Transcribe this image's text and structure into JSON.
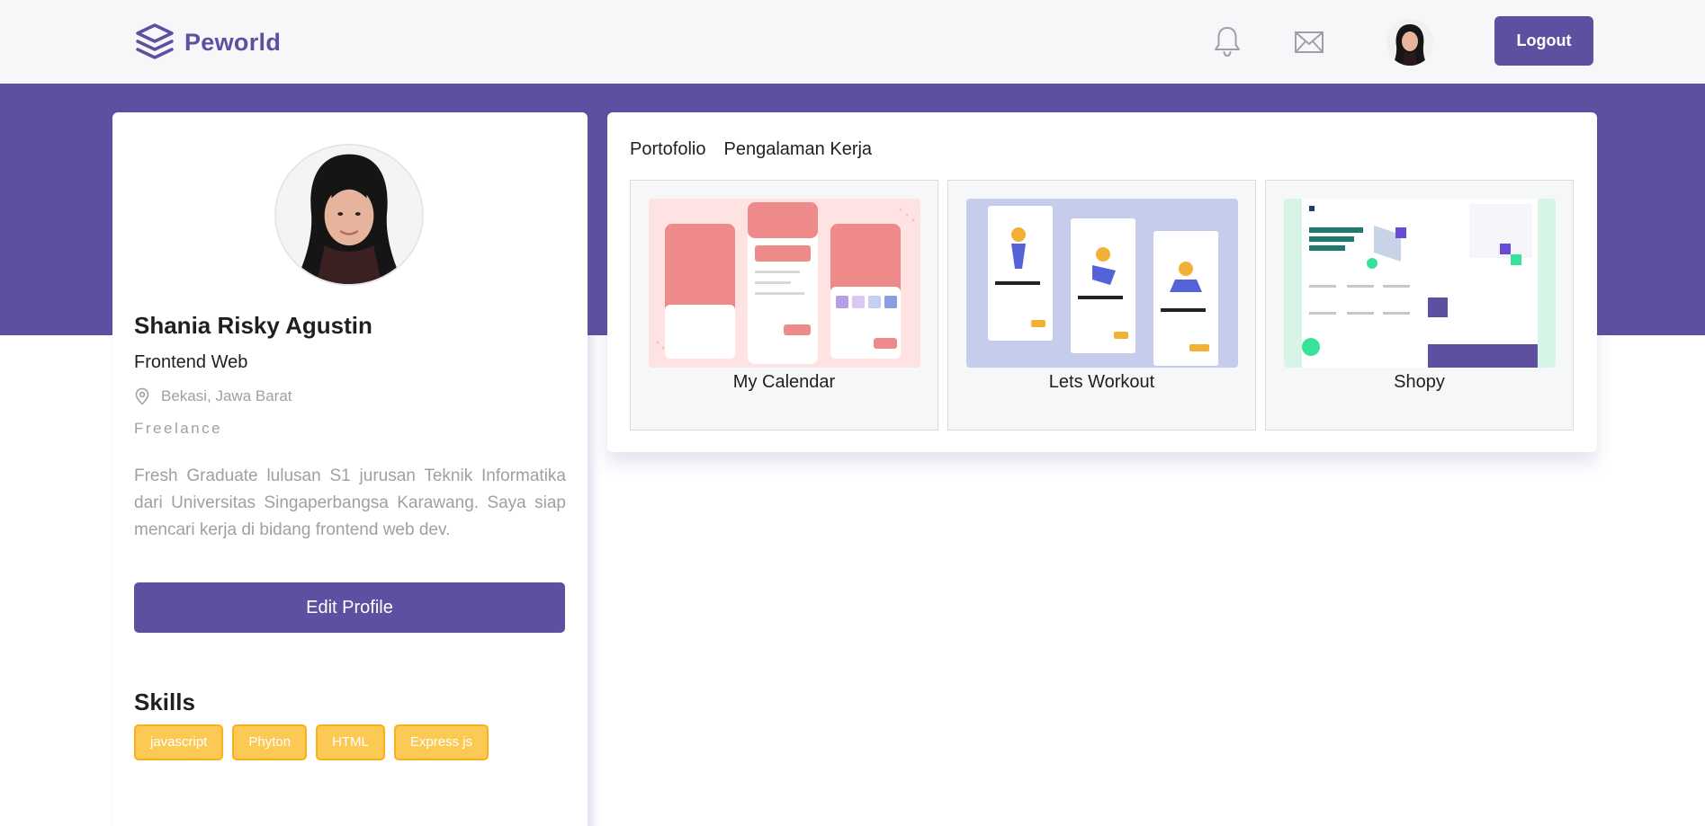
{
  "navbar": {
    "brand": "Peworld",
    "logout_label": "Logout",
    "icons": [
      "layers-icon",
      "bell-icon",
      "mail-icon"
    ]
  },
  "colors": {
    "primary": "#5e50a1",
    "skill_bg": "#fbc954",
    "skill_border": "#fbb017",
    "muted_text": "#9ea0a5",
    "page_bg": "#f6f7f8"
  },
  "profile": {
    "name": "Shania Risky Agustin",
    "role": "Frontend Web",
    "location": "Bekasi, Jawa Barat",
    "job_type": "Freelance",
    "bio": "Fresh Graduate lulusan S1 jurusan Teknik Informatika dari Universitas Singaperbangsa Karawang. Saya siap mencari kerja di bidang frontend web dev.",
    "edit_label": "Edit Profile",
    "skills_title": "Skills",
    "skills": [
      "javascript",
      "Phyton",
      "HTML",
      "Express js"
    ]
  },
  "tabs": [
    "Portofolio",
    "Pengalaman Kerja"
  ],
  "portfolio": [
    {
      "title": "My Calendar"
    },
    {
      "title": "Lets Workout"
    },
    {
      "title": "Shopy"
    }
  ]
}
